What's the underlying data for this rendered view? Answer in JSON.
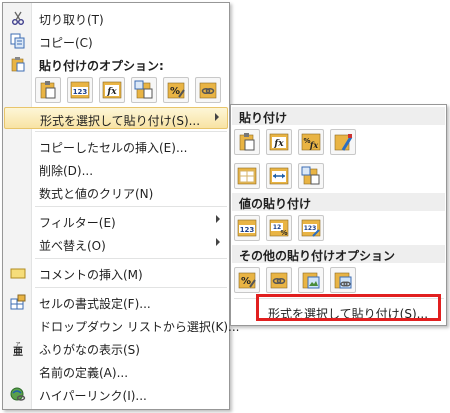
{
  "main_menu": {
    "cut": "切り取り(T)",
    "copy": "コピー(C)",
    "paste_options_header": "貼り付けのオプション:",
    "paste_options_icons": [
      "paste-icon",
      "paste-values-icon",
      "paste-formulas-icon",
      "paste-transpose-icon",
      "paste-formatting-icon",
      "paste-link-icon"
    ],
    "paste_special": "形式を選択して貼り付け(S)...",
    "insert_copied_cells": "コピーしたセルの挿入(E)...",
    "delete": "削除(D)...",
    "clear_contents": "数式と値のクリア(N)",
    "filter": "フィルター(E)",
    "sort": "並べ替え(O)",
    "insert_comment": "コメントの挿入(M)",
    "format_cells": "セルの書式設定(F)...",
    "pick_from_dropdown": "ドロップダウン リストから選択(K)...",
    "show_phonetic": "ふりがなの表示(S)",
    "define_name": "名前の定義(A)...",
    "hyperlink": "ハイパーリンク(I)..."
  },
  "sub_menu": {
    "paste_header": "貼り付け",
    "paste_values_header": "値の貼り付け",
    "other_paste_header": "その他の貼り付けオプション",
    "paste_special": "形式を選択して貼り付け(S)..."
  },
  "icons": {
    "values_text": "123",
    "formula_text": "fx",
    "percent_text": "%"
  },
  "colors": {
    "hover_bg": "#f8e3a4",
    "highlight_border": "#e11f1f",
    "paste_gold": "#e9b444"
  }
}
